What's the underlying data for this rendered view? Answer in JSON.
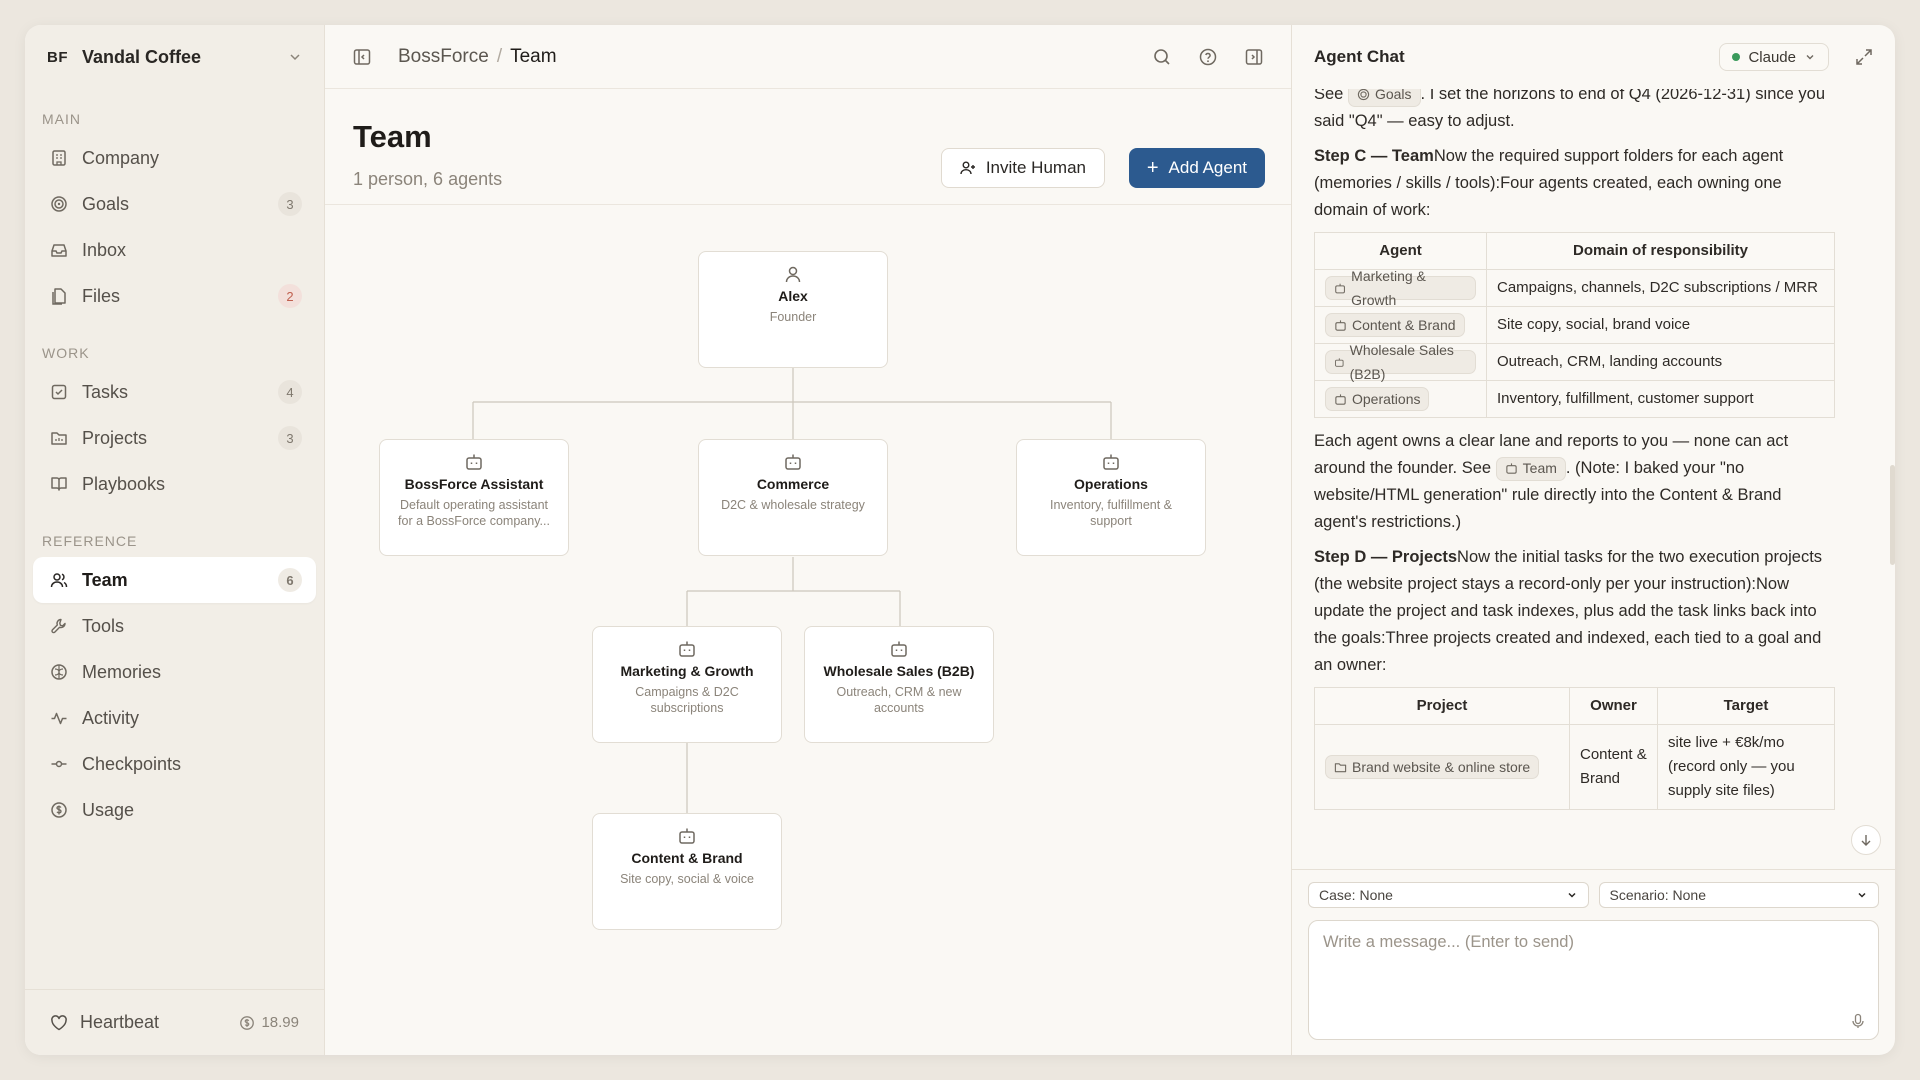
{
  "sidebar": {
    "workspace_badge": "BF",
    "workspace_name": "Vandal Coffee",
    "sections": {
      "main": "MAIN",
      "work": "WORK",
      "reference": "REFERENCE"
    },
    "items": {
      "company": {
        "label": "Company",
        "count": ""
      },
      "goals": {
        "label": "Goals",
        "count": "3"
      },
      "inbox": {
        "label": "Inbox",
        "count": ""
      },
      "files": {
        "label": "Files",
        "count": "2"
      },
      "tasks": {
        "label": "Tasks",
        "count": "4"
      },
      "projects": {
        "label": "Projects",
        "count": "3"
      },
      "playbooks": {
        "label": "Playbooks",
        "count": ""
      },
      "team": {
        "label": "Team",
        "count": "6"
      },
      "tools": {
        "label": "Tools",
        "count": ""
      },
      "memories": {
        "label": "Memories",
        "count": ""
      },
      "activity": {
        "label": "Activity",
        "count": ""
      },
      "checkpoints": {
        "label": "Checkpoints",
        "count": ""
      },
      "usage": {
        "label": "Usage",
        "count": ""
      }
    },
    "footer": {
      "label": "Heartbeat",
      "credits": "18.99"
    }
  },
  "topbar": {
    "crumb_root": "BossForce",
    "crumb_sep": "/",
    "crumb_current": "Team"
  },
  "page": {
    "title": "Team",
    "subtitle": "1 person, 6 agents",
    "invite_label": "Invite Human",
    "add_agent_label": "Add Agent"
  },
  "org": {
    "alex": {
      "name": "Alex",
      "desc": "Founder"
    },
    "assistant": {
      "name": "BossForce Assistant",
      "desc": "Default operating assistant for a BossForce company..."
    },
    "commerce": {
      "name": "Commerce",
      "desc": "D2C & wholesale strategy"
    },
    "operations": {
      "name": "Operations",
      "desc": "Inventory, fulfillment & support"
    },
    "marketing": {
      "name": "Marketing & Growth",
      "desc": "Campaigns & D2C subscriptions"
    },
    "wholesale": {
      "name": "Wholesale Sales (B2B)",
      "desc": "Outreach, CRM & new accounts"
    },
    "content": {
      "name": "Content & Brand",
      "desc": "Site copy, social & voice"
    }
  },
  "chat": {
    "title": "Agent Chat",
    "model": "Claude",
    "p1": {
      "pre": "See",
      "chip": "Goals",
      "post": ". I set the horizons to end of Q4 (2026-12-31) since you said \"Q4\" — easy to adjust."
    },
    "p2": {
      "bold": "Step C — Team",
      "text": "Now the required support folders for each agent (memories / skills / tools):Four agents created, each owning one domain of work:"
    },
    "agents_table": {
      "headers": [
        "Agent",
        "Domain of responsibility"
      ],
      "rows": [
        {
          "agent": "Marketing & Growth",
          "domain": "Campaigns, channels, D2C subscriptions / MRR"
        },
        {
          "agent": "Content & Brand",
          "domain": "Site copy, social, brand voice"
        },
        {
          "agent": "Wholesale Sales (B2B)",
          "domain": "Outreach, CRM, landing accounts"
        },
        {
          "agent": "Operations",
          "domain": "Inventory, fulfillment, customer support"
        }
      ]
    },
    "p3": {
      "pre": "Each agent owns a clear lane and reports to you — none can act around the founder. See",
      "chip": "Team",
      "post": ". (Note: I baked your \"no website/HTML generation\" rule directly into the Content & Brand agent's restrictions.)"
    },
    "p4": {
      "bold": "Step D — Projects",
      "text": "Now the initial tasks for the two execution projects (the website project stays a record-only per your instruction):Now update the project and task indexes, plus add the task links back into the goals:Three projects created and indexed, each tied to a goal and an owner:"
    },
    "projects_table": {
      "headers": [
        "Project",
        "Owner",
        "Target"
      ],
      "rows": [
        {
          "project": "Brand website & online store",
          "owner": "Content & Brand",
          "target": "site live + €8k/mo (record only — you supply site files)"
        }
      ]
    },
    "case_select": "Case: None",
    "scenario_select": "Scenario: None",
    "composer_placeholder": "Write a message... (Enter to send)"
  }
}
